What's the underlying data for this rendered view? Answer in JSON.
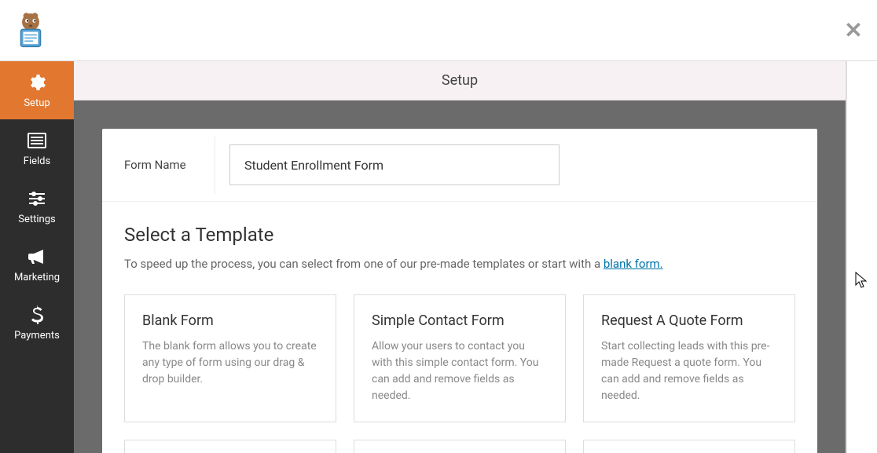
{
  "sidebar": {
    "items": [
      {
        "label": "Setup",
        "icon": "gear"
      },
      {
        "label": "Fields",
        "icon": "list"
      },
      {
        "label": "Settings",
        "icon": "sliders"
      },
      {
        "label": "Marketing",
        "icon": "bullhorn"
      },
      {
        "label": "Payments",
        "icon": "dollar"
      }
    ]
  },
  "header": {
    "title": "Setup"
  },
  "form_name": {
    "label": "Form Name",
    "value": "Student Enrollment Form"
  },
  "templates": {
    "heading": "Select a Template",
    "description_prefix": "To speed up the process, you can select from one of our pre-made templates or start with a ",
    "link_text": "blank form.",
    "cards": [
      {
        "title": "Blank Form",
        "desc": "The blank form allows you to create any type of form using our drag & drop builder."
      },
      {
        "title": "Simple Contact Form",
        "desc": "Allow your users to contact you with this simple contact form. You can add and remove fields as needed."
      },
      {
        "title": "Request A Quote Form",
        "desc": "Start collecting leads with this pre-made Request a quote form. You can add and remove fields as needed."
      }
    ]
  }
}
